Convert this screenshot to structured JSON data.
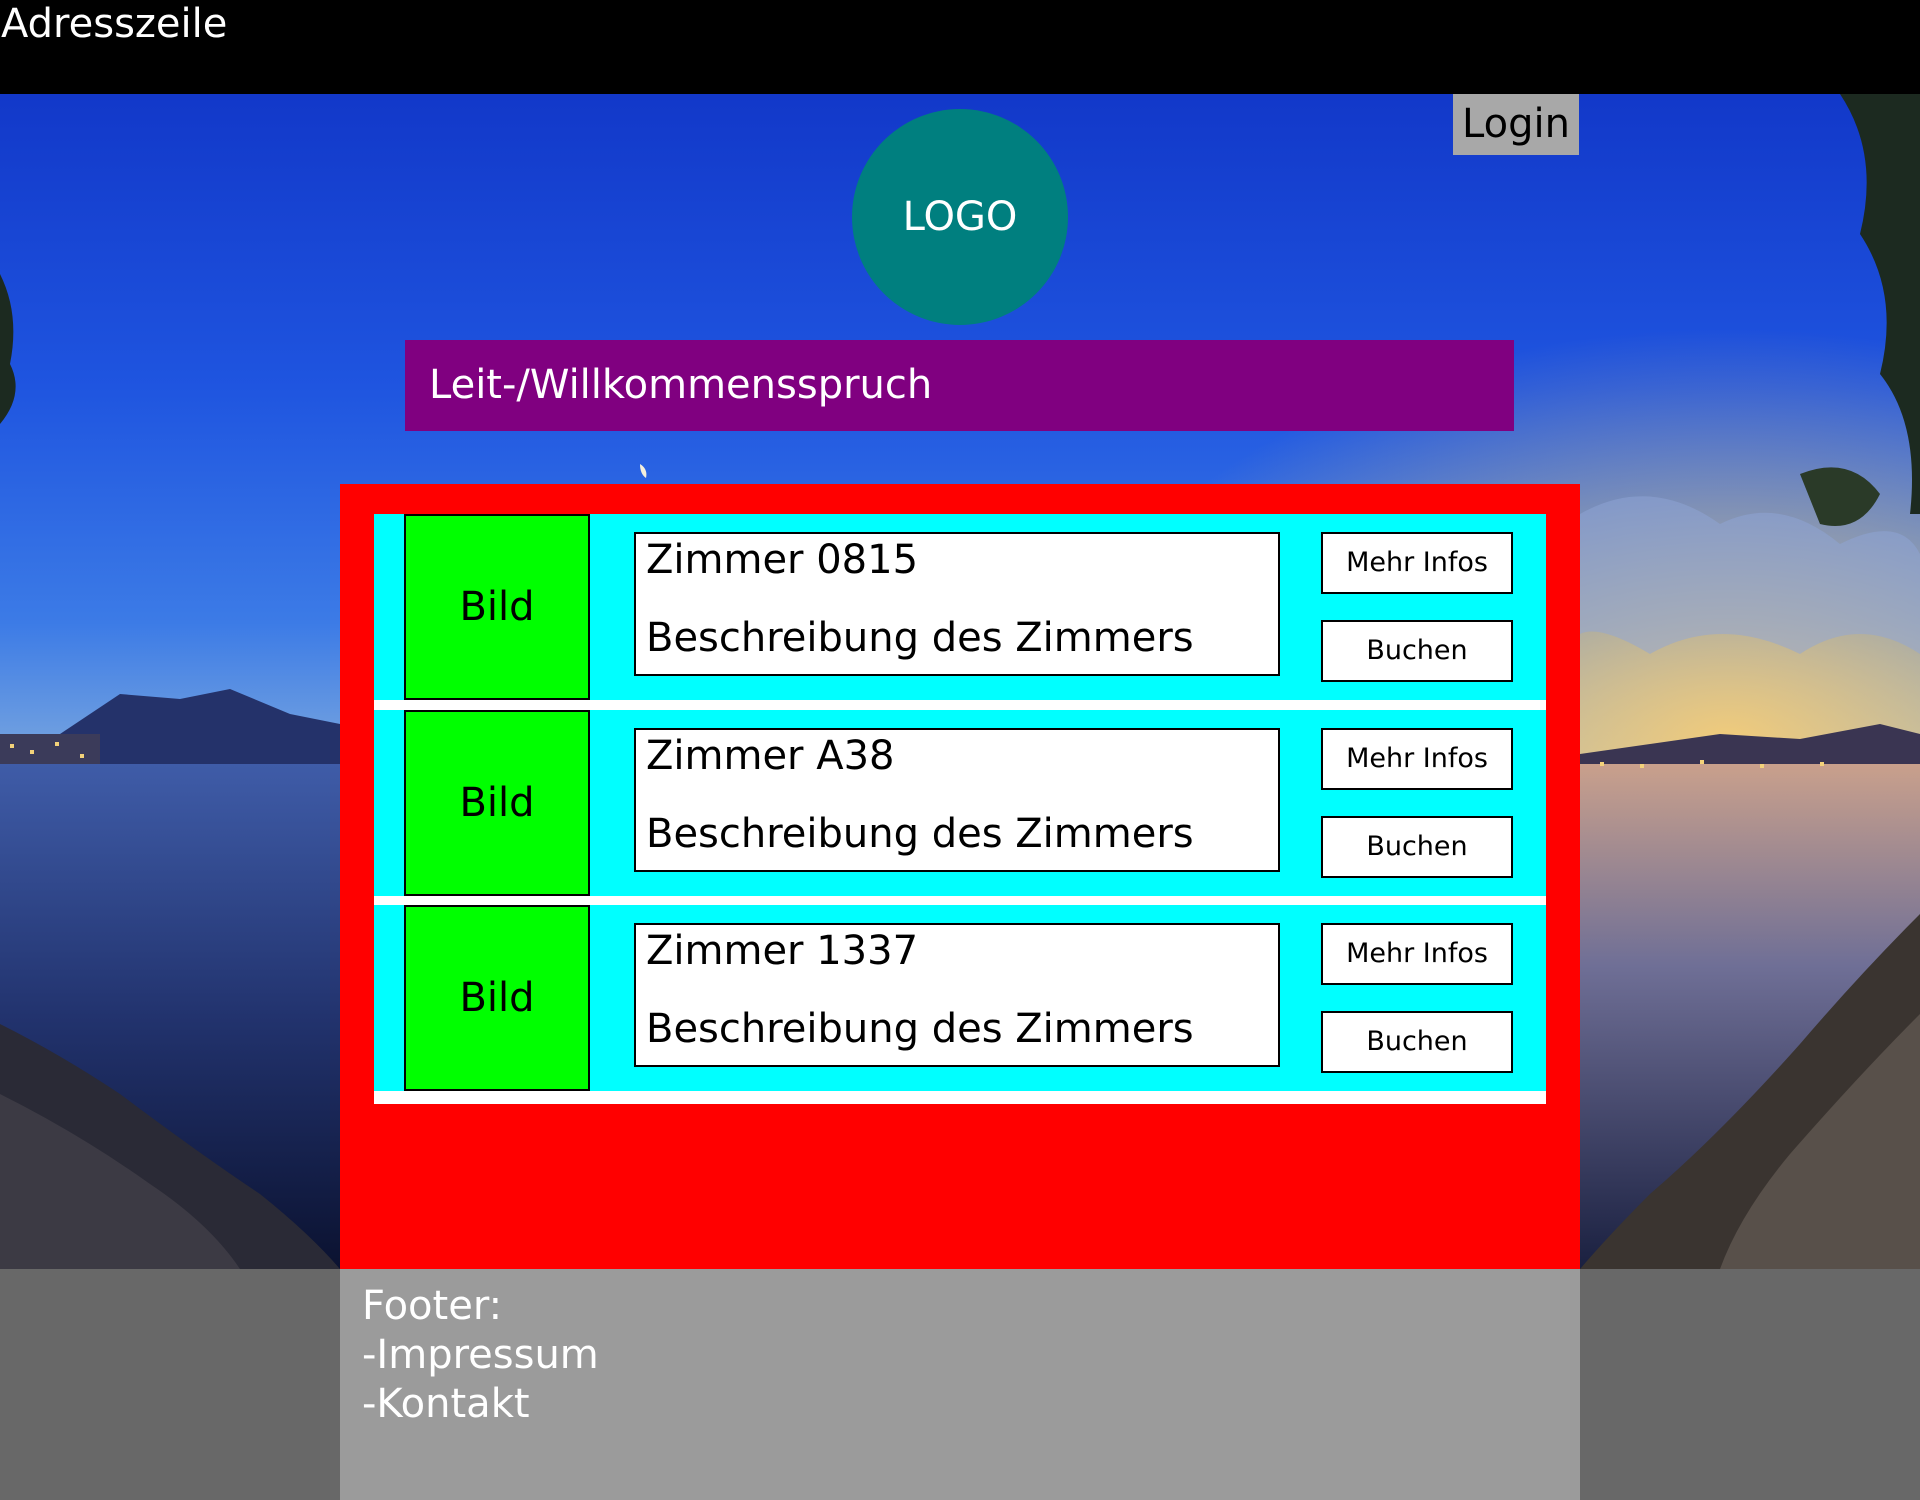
{
  "address_bar": {
    "label": "Adresszeile"
  },
  "header": {
    "login_label": "Login",
    "logo_text": "LOGO",
    "slogan": "Leit-/Willkommensspruch"
  },
  "rooms": [
    {
      "image_label": "Bild",
      "name": "Zimmer 0815",
      "description": "Beschreibung des Zimmers",
      "more_info_label": "Mehr Infos",
      "book_label": "Buchen"
    },
    {
      "image_label": "Bild",
      "name": "Zimmer A38",
      "description": "Beschreibung des Zimmers",
      "more_info_label": "Mehr Infos",
      "book_label": "Buchen"
    },
    {
      "image_label": "Bild",
      "name": "Zimmer 1337",
      "description": "Beschreibung des Zimmers",
      "more_info_label": "Mehr Infos",
      "book_label": "Buchen"
    }
  ],
  "footer": {
    "heading": "Footer:",
    "links": [
      "-Impressum",
      "-Kontakt"
    ]
  },
  "colors": {
    "address_bar": "#000000",
    "login_button": "#a8a8a8",
    "logo": "#007f7f",
    "slogan_bar": "#800080",
    "main_area": "#ff0000",
    "room_row": "#00ffff",
    "room_image": "#00ff00",
    "footer_outer": "#686868",
    "footer_inner": "#9b9b9b"
  }
}
